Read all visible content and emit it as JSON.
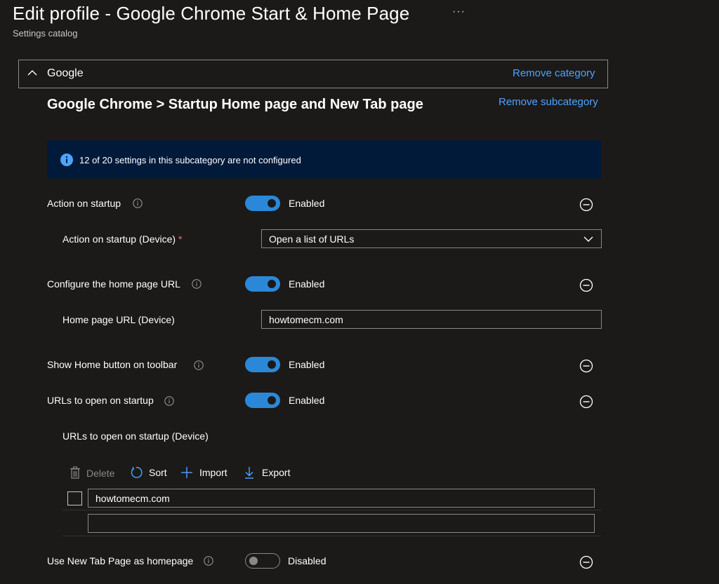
{
  "header": {
    "title": "Edit profile - Google Chrome Start & Home Page",
    "subtitle": "Settings catalog",
    "more_icon": "ellipsis-icon"
  },
  "category": {
    "label": "Google",
    "remove_label": "Remove category"
  },
  "subcategory": {
    "title": "Google Chrome > Startup Home page and New Tab page",
    "remove_label": "Remove subcategory"
  },
  "info_banner": {
    "text": "12 of 20 settings in this subcategory are not configured"
  },
  "settings": {
    "action_on_startup": {
      "label": "Action on startup",
      "state": "Enabled",
      "on": true
    },
    "action_on_startup_device": {
      "label": "Action on startup (Device)",
      "required_mark": "*",
      "value": "Open a list of URLs"
    },
    "home_page_url": {
      "label": "Configure the home page URL",
      "state": "Enabled",
      "on": true
    },
    "home_page_url_device": {
      "label": "Home page URL (Device)",
      "value": "howtomecm.com"
    },
    "show_home_button": {
      "label": "Show Home button on toolbar",
      "state": "Enabled",
      "on": true
    },
    "urls_on_startup": {
      "label": "URLs to open on startup",
      "state": "Enabled",
      "on": true
    },
    "urls_on_startup_device": {
      "label": "URLs to open on startup (Device)"
    },
    "new_tab_homepage": {
      "label": "Use New Tab Page as homepage",
      "state": "Disabled",
      "on": false
    }
  },
  "url_toolbar": {
    "delete_label": "Delete",
    "sort_label": "Sort",
    "import_label": "Import",
    "export_label": "Export"
  },
  "url_list": {
    "rows": [
      "howtomecm.com",
      ""
    ]
  },
  "colors": {
    "background": "#1b1a19",
    "accent": "#2b88d8",
    "link": "#4ea3ff",
    "banner": "#021a3a",
    "required": "#f1707b"
  }
}
